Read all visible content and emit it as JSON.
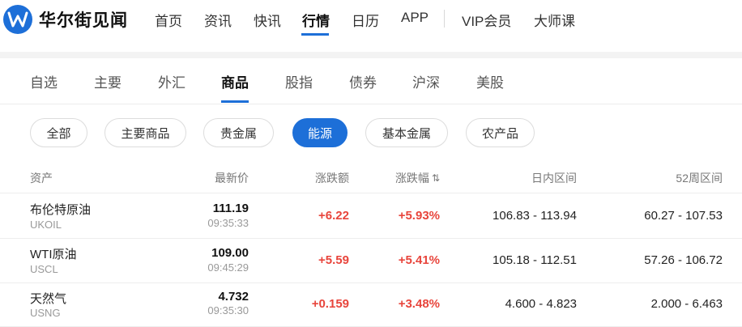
{
  "brand": {
    "name": "华尔街见闻",
    "accent": "#1d6fd8"
  },
  "nav": {
    "items": [
      {
        "label": "首页",
        "active": false
      },
      {
        "label": "资讯",
        "active": false
      },
      {
        "label": "快讯",
        "active": false
      },
      {
        "label": "行情",
        "active": true
      },
      {
        "label": "日历",
        "active": false
      },
      {
        "label": "APP",
        "active": false
      },
      {
        "label": "VIP会员",
        "active": false
      },
      {
        "label": "大师课",
        "active": false
      }
    ]
  },
  "tabs": [
    {
      "label": "自选",
      "active": false
    },
    {
      "label": "主要",
      "active": false
    },
    {
      "label": "外汇",
      "active": false
    },
    {
      "label": "商品",
      "active": true
    },
    {
      "label": "股指",
      "active": false
    },
    {
      "label": "债券",
      "active": false
    },
    {
      "label": "沪深",
      "active": false
    },
    {
      "label": "美股",
      "active": false
    }
  ],
  "filters": [
    {
      "label": "全部",
      "active": false
    },
    {
      "label": "主要商品",
      "active": false
    },
    {
      "label": "贵金属",
      "active": false
    },
    {
      "label": "能源",
      "active": true
    },
    {
      "label": "基本金属",
      "active": false
    },
    {
      "label": "农产品",
      "active": false
    }
  ],
  "table": {
    "columns": {
      "asset": "资产",
      "price": "最新价",
      "change": "涨跌额",
      "change_pct": "涨跌幅",
      "day_range": "日内区间",
      "week52_range": "52周区间"
    },
    "up_color": "#e8453c",
    "rows": [
      {
        "name": "布伦特原油",
        "code": "UKOIL",
        "price": "111.19",
        "time": "09:35:33",
        "change": "+6.22",
        "change_pct": "+5.93%",
        "day_range": "106.83 - 113.94",
        "week52_range": "60.27 - 107.53"
      },
      {
        "name": "WTI原油",
        "code": "USCL",
        "price": "109.00",
        "time": "09:45:29",
        "change": "+5.59",
        "change_pct": "+5.41%",
        "day_range": "105.18 - 112.51",
        "week52_range": "57.26 - 106.72"
      },
      {
        "name": "天然气",
        "code": "USNG",
        "price": "4.732",
        "time": "09:35:30",
        "change": "+0.159",
        "change_pct": "+3.48%",
        "day_range": "4.600 - 4.823",
        "week52_range": "2.000 - 6.463"
      }
    ]
  }
}
